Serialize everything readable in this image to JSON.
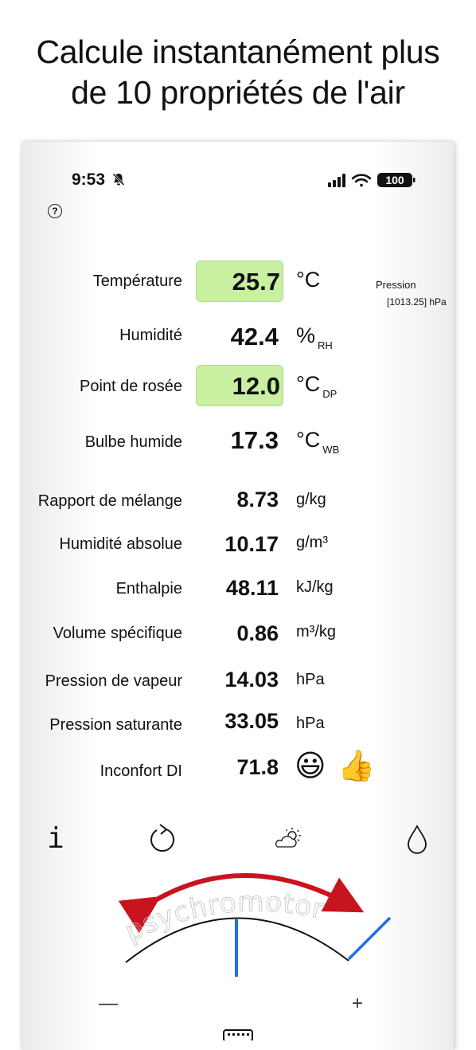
{
  "headline": {
    "line1": "Calcule instantanément plus",
    "line2": "de 10 propriétés de l'air"
  },
  "status_bar": {
    "time": "9:53",
    "battery": "100"
  },
  "pressure": {
    "label": "Pression",
    "value": "[1013.25] hPa"
  },
  "rows": [
    {
      "label": "Température",
      "value": "25.7",
      "unit": "°C",
      "sub": ""
    },
    {
      "label": "Humidité",
      "value": "42.4",
      "unit": "%",
      "sub": "RH"
    },
    {
      "label": "Point de rosée",
      "value": "12.0",
      "unit": "°C",
      "sub": "DP"
    },
    {
      "label": "Bulbe humide",
      "value": "17.3",
      "unit": "°C",
      "sub": "WB"
    },
    {
      "label": "Rapport de mélange",
      "value": "8.73",
      "unit": "g/kg"
    },
    {
      "label": "Humidité absolue",
      "value": "10.17",
      "unit": "g/m³"
    },
    {
      "label": "Enthalpie",
      "value": "48.11",
      "unit": "kJ/kg"
    },
    {
      "label": "Volume spécifique",
      "value": "0.86",
      "unit": "m³/kg"
    },
    {
      "label": "Pression de vapeur",
      "value": "14.03",
      "unit": "hPa"
    },
    {
      "label": "Pression saturante",
      "value": "33.05",
      "unit": "hPa"
    },
    {
      "label": "Inconfort DI",
      "value": "71.8",
      "emojis": [
        "😃",
        "👍"
      ]
    }
  ],
  "toolbar": {
    "info_label": "i"
  },
  "dial": {
    "label": "psychromotor",
    "minus": "—",
    "plus": "+"
  },
  "colors": {
    "highlight": "#c8f0a0",
    "arrow": "#c8141e",
    "needle": "#1e6ee6"
  },
  "icons": [
    "help-icon",
    "info-icon",
    "reset-icon",
    "weather-icon",
    "water-drop-icon",
    "keyboard-icon"
  ]
}
